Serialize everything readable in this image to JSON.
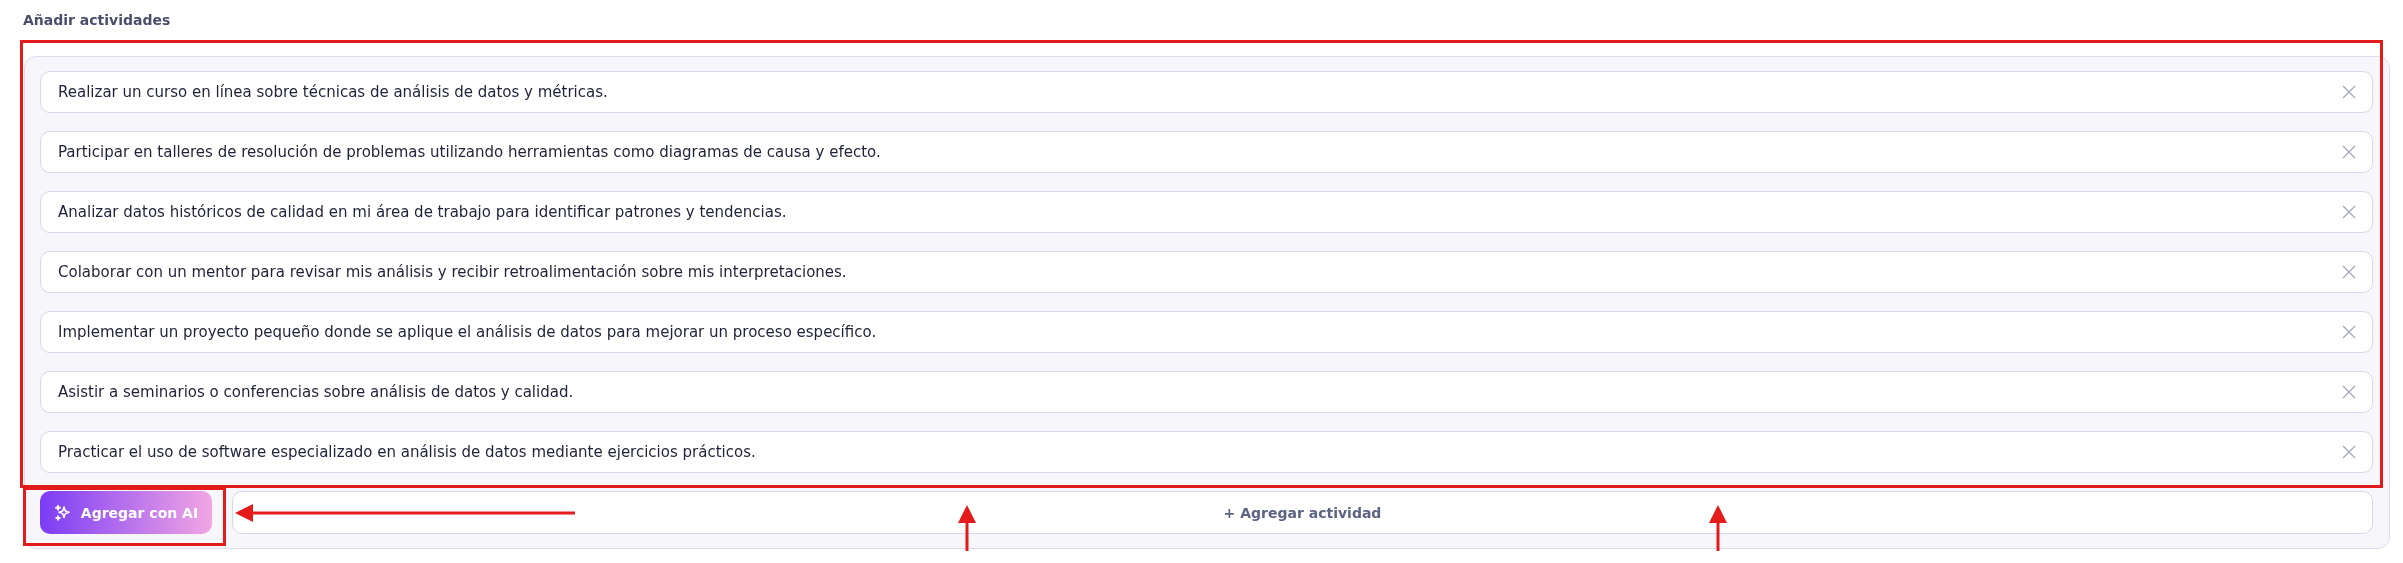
{
  "section_title": "Añadir actividades",
  "activities": [
    {
      "text": "Realizar un curso en línea sobre técnicas de análisis de datos y métricas."
    },
    {
      "text": "Participar en talleres de resolución de problemas utilizando herramientas como diagramas de causa y efecto."
    },
    {
      "text": "Analizar datos históricos de calidad en mi área de trabajo para identificar patrones y tendencias."
    },
    {
      "text": "Colaborar con un mentor para revisar mis análisis y recibir retroalimentación sobre mis interpretaciones."
    },
    {
      "text": "Implementar un proyecto pequeño donde se aplique el análisis de datos para mejorar un proceso específico."
    },
    {
      "text": "Asistir a seminarios o conferencias sobre análisis de datos y calidad."
    },
    {
      "text": "Practicar el uso de software especializado en análisis de datos mediante ejercicios prácticos."
    }
  ],
  "ai_button": "Agregar con AI",
  "add_button": "+ Agregar actividad"
}
